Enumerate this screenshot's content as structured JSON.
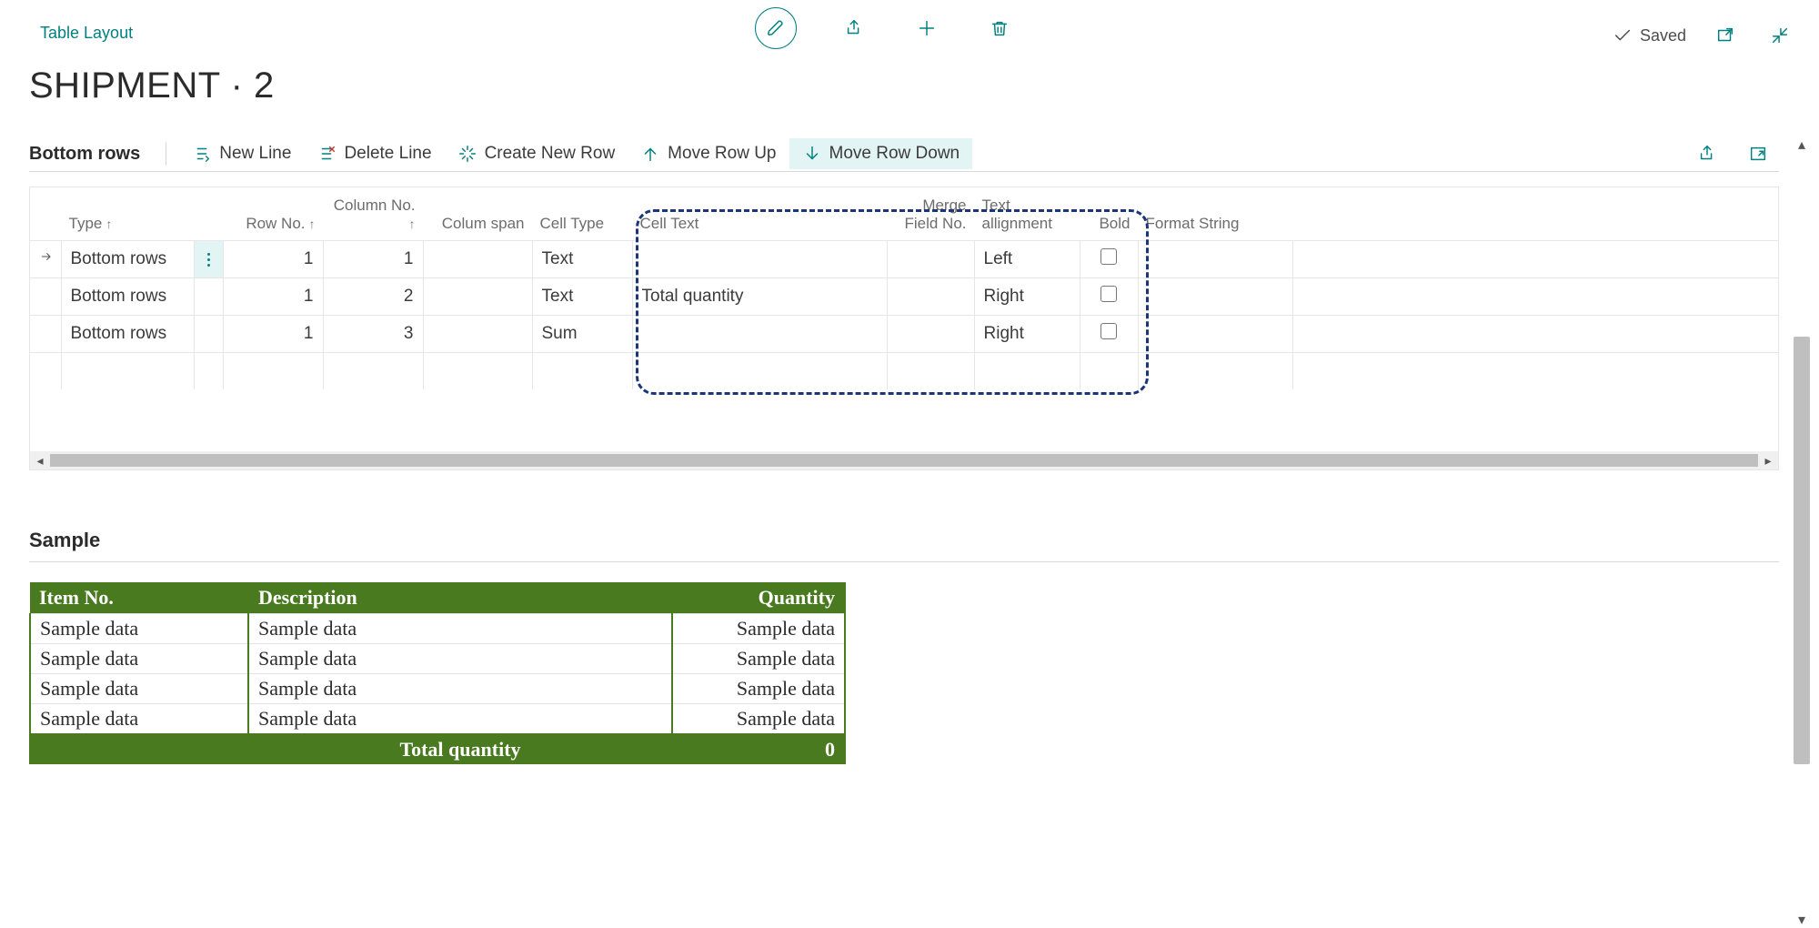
{
  "header": {
    "breadcrumb": "Table Layout",
    "title": "SHIPMENT · 2",
    "saved_label": "Saved"
  },
  "subbar": {
    "section_label": "Bottom rows",
    "new_line": "New Line",
    "delete_line": "Delete Line",
    "create_new_row": "Create New Row",
    "move_row_up": "Move Row Up",
    "move_row_down": "Move Row Down"
  },
  "grid": {
    "columns": {
      "type": "Type",
      "row_no": "Row No.",
      "column_no": "Column No.",
      "colum_span": "Colum span",
      "cell_type": "Cell Type",
      "cell_text": "Cell Text",
      "merge_field_no": "Merge Field No.",
      "text_alignment": "Text allignment",
      "bold": "Bold",
      "format_string": "Format String"
    },
    "rows": [
      {
        "type": "Bottom rows",
        "row_no": "1",
        "column_no": "1",
        "colum_span": "",
        "cell_type": "Text",
        "cell_text": "",
        "merge_field_no": "",
        "text_alignment": "Left",
        "bold": false,
        "format_string": ""
      },
      {
        "type": "Bottom rows",
        "row_no": "1",
        "column_no": "2",
        "colum_span": "",
        "cell_type": "Text",
        "cell_text": "Total quantity",
        "merge_field_no": "",
        "text_alignment": "Right",
        "bold": false,
        "format_string": ""
      },
      {
        "type": "Bottom rows",
        "row_no": "1",
        "column_no": "3",
        "colum_span": "",
        "cell_type": "Sum",
        "cell_text": "",
        "merge_field_no": "",
        "text_alignment": "Right",
        "bold": false,
        "format_string": ""
      }
    ]
  },
  "sample": {
    "section_title": "Sample",
    "headers": {
      "item_no": "Item No.",
      "description": "Description",
      "quantity": "Quantity"
    },
    "cell": "Sample data",
    "rows": 4,
    "footer": {
      "label": "Total quantity",
      "value": "0"
    }
  }
}
